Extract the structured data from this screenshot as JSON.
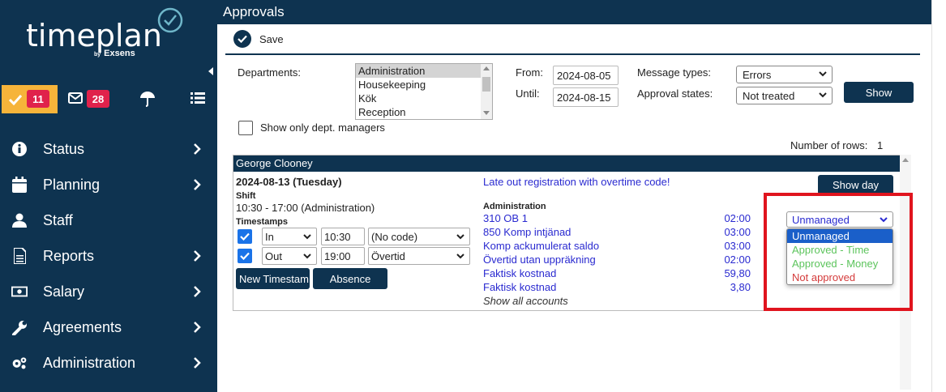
{
  "app": {
    "logo_text": "timeplan",
    "logo_by": "by",
    "logo_brand": "Exsens"
  },
  "quickbar": {
    "approvals_count": "11",
    "messages_count": "28"
  },
  "nav": [
    {
      "label": "Status",
      "icon": "info-circle-icon"
    },
    {
      "label": "Planning",
      "icon": "calendar-icon"
    },
    {
      "label": "Staff",
      "icon": "user-icon"
    },
    {
      "label": "Reports",
      "icon": "document-icon"
    },
    {
      "label": "Salary",
      "icon": "money-icon"
    },
    {
      "label": "Agreements",
      "icon": "wrench-icon"
    },
    {
      "label": "Administration",
      "icon": "cogs-icon"
    }
  ],
  "page": {
    "title": "Approvals",
    "save_label": "Save"
  },
  "filters": {
    "departments_label": "Departments:",
    "departments": [
      "Administration",
      "Housekeeping",
      "Kök",
      "Reception"
    ],
    "selected_department": "Administration",
    "from_label": "From:",
    "until_label": "Until:",
    "from_value": "2024-08-05",
    "until_value": "2024-08-15",
    "message_types_label": "Message types:",
    "message_types_value": "Errors",
    "approval_states_label": "Approval states:",
    "approval_states_value": "Not treated",
    "show_button": "Show",
    "only_managers_label": "Show only dept. managers",
    "rows_label": "Number of rows:",
    "rows_value": "1"
  },
  "employee": {
    "name": "George Clooney",
    "date": "2024-08-13 (Tuesday)",
    "shift_label": "Shift",
    "shift_value": "10:30 - 17:00 (Administration)",
    "timestamps_label": "Timestamps",
    "timestamps": [
      {
        "direction": "In",
        "time": "10:30",
        "code": "(No code)"
      },
      {
        "direction": "Out",
        "time": "19:00",
        "code": "Övertid"
      }
    ],
    "new_timestamp_button": "New Timestam",
    "absence_button": "Absence",
    "message": "Late out registration with overtime code!",
    "show_day_button": "Show day",
    "accounts_header": "Administration",
    "accounts": [
      {
        "name": "310 OB 1",
        "value": "02:00"
      },
      {
        "name": "850 Komp intjänad",
        "value": "03:00"
      },
      {
        "name": "Komp ackumulerat saldo",
        "value": "03:00"
      },
      {
        "name": "Övertid utan uppräkning",
        "value": "02:00"
      },
      {
        "name": "Faktisk kostnad",
        "value": "59,80"
      },
      {
        "name": "Faktisk kostnad",
        "value": "3,80"
      }
    ],
    "show_all_accounts": "Show all accounts",
    "approval_select": "Unmanaged",
    "approval_options": [
      {
        "label": "Unmanaged",
        "color": "#ffffff"
      },
      {
        "label": "Approved - Time",
        "color": "#5cc45c"
      },
      {
        "label": "Approved - Money",
        "color": "#5cc45c"
      },
      {
        "label": "Not approved",
        "color": "#d43a3a"
      }
    ]
  },
  "colors": {
    "navy": "#0e3350",
    "accent_yellow": "#f6b43a",
    "badge_red": "#e0224b",
    "highlight_red": "#e0141e"
  }
}
